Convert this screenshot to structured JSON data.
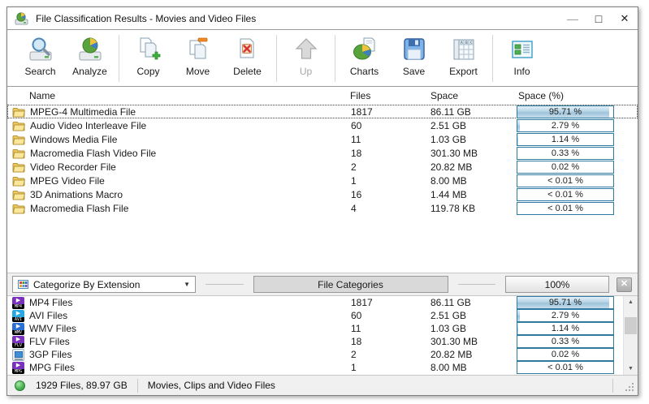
{
  "titlebar": {
    "title": "File Classification Results - Movies and Video Files",
    "minimize_glyph": "—",
    "maximize_glyph": "□",
    "close_glyph": "✕"
  },
  "toolbar": {
    "buttons": [
      {
        "label": "Search",
        "icon": "search-disk-icon",
        "enabled": true
      },
      {
        "label": "Analyze",
        "icon": "analyze-disk-icon",
        "enabled": true
      },
      {
        "label": "Copy",
        "icon": "copy-files-icon",
        "enabled": true
      },
      {
        "label": "Move",
        "icon": "move-files-icon",
        "enabled": true
      },
      {
        "label": "Delete",
        "icon": "delete-files-icon",
        "enabled": true
      },
      {
        "label": "Up",
        "icon": "up-arrow-icon",
        "enabled": false
      },
      {
        "label": "Charts",
        "icon": "charts-pie-icon",
        "enabled": true
      },
      {
        "label": "Save",
        "icon": "save-floppy-icon",
        "enabled": true
      },
      {
        "label": "Export",
        "icon": "export-grid-icon",
        "enabled": true
      },
      {
        "label": "Info",
        "icon": "info-panel-icon",
        "enabled": true
      }
    ]
  },
  "table": {
    "columns": [
      "Name",
      "Files",
      "Space",
      "Space (%)"
    ]
  },
  "top_table": {
    "rows": [
      {
        "name": "MPEG-4 Multimedia File",
        "files": "1817",
        "space": "86.11 GB",
        "percent_label": "95.71 %",
        "percent": 95.71,
        "selected": true
      },
      {
        "name": "Audio Video Interleave File",
        "files": "60",
        "space": "2.51 GB",
        "percent_label": "2.79 %",
        "percent": 2.79,
        "selected": false
      },
      {
        "name": "Windows Media File",
        "files": "11",
        "space": "1.03 GB",
        "percent_label": "1.14 %",
        "percent": 1.14,
        "selected": false
      },
      {
        "name": "Macromedia Flash Video File",
        "files": "18",
        "space": "301.30 MB",
        "percent_label": "0.33 %",
        "percent": 0.33,
        "selected": false
      },
      {
        "name": "Video Recorder File",
        "files": "2",
        "space": "20.82 MB",
        "percent_label": "0.02 %",
        "percent": 0.02,
        "selected": false
      },
      {
        "name": "MPEG Video File",
        "files": "1",
        "space": "8.00 MB",
        "percent_label": "< 0.01 %",
        "percent": 0,
        "selected": false
      },
      {
        "name": "3D Animations Macro",
        "files": "16",
        "space": "1.44 MB",
        "percent_label": "< 0.01 %",
        "percent": 0,
        "selected": false
      },
      {
        "name": "Macromedia Flash File",
        "files": "4",
        "space": "119.78 KB",
        "percent_label": "< 0.01 %",
        "percent": 0,
        "selected": false
      }
    ]
  },
  "middle_bar": {
    "dropdown_label": "Categorize By Extension",
    "dropdown_arrow_glyph": "▼",
    "categories_button": "File Categories",
    "zoom_button": "100%",
    "close_glyph": "✕"
  },
  "bottom_table": {
    "rows": [
      {
        "name": "MP4 Files",
        "ext": "MP4",
        "icon_style": "media",
        "icon_color": "#7b2fbe",
        "files": "1817",
        "space": "86.11 GB",
        "percent_label": "95.71 %",
        "percent": 95.71
      },
      {
        "name": "AVI Files",
        "ext": "AVI",
        "icon_style": "media",
        "icon_color": "#29a8e0",
        "files": "60",
        "space": "2.51 GB",
        "percent_label": "2.79 %",
        "percent": 2.79
      },
      {
        "name": "WMV Files",
        "ext": "WMV",
        "icon_style": "media",
        "icon_color": "#2a6fd4",
        "files": "11",
        "space": "1.03 GB",
        "percent_label": "1.14 %",
        "percent": 1.14
      },
      {
        "name": "FLV Files",
        "ext": "FLV",
        "icon_style": "media",
        "icon_color": "#7b2fbe",
        "files": "18",
        "space": "301.30 MB",
        "percent_label": "0.33 %",
        "percent": 0.33
      },
      {
        "name": "3GP Files",
        "ext": "3GP",
        "icon_style": "phone",
        "icon_color": "#9fb0bc",
        "files": "2",
        "space": "20.82 MB",
        "percent_label": "0.02 %",
        "percent": 0.02
      },
      {
        "name": "MPG Files",
        "ext": "MPG",
        "icon_style": "media",
        "icon_color": "#7b2fbe",
        "files": "1",
        "space": "8.00 MB",
        "percent_label": "< 0.01 %",
        "percent": 0
      }
    ]
  },
  "scrollbar": {
    "up_glyph": "▲",
    "down_glyph": "▼"
  },
  "status_bar": {
    "files_summary": "1929 Files, 89.97 GB",
    "category_label": "Movies, Clips and Video Files"
  },
  "colors": {
    "bar_border": "#2f7aa0",
    "bar_fill": "#aecfe3",
    "status_led": "#47b04f",
    "folder": "#f6d878"
  }
}
